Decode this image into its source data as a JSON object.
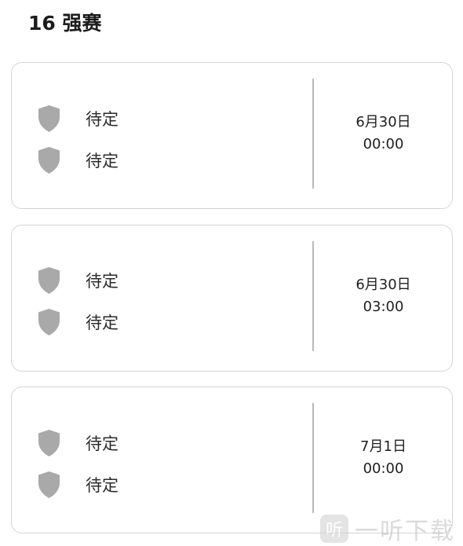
{
  "section": {
    "title": "16 强赛"
  },
  "matches": [
    {
      "home": {
        "name": "待定",
        "icon": "shield-icon"
      },
      "away": {
        "name": "待定",
        "icon": "shield-icon"
      },
      "date": "6月30日",
      "time": "00:00"
    },
    {
      "home": {
        "name": "待定",
        "icon": "shield-icon"
      },
      "away": {
        "name": "待定",
        "icon": "shield-icon"
      },
      "date": "6月30日",
      "time": "03:00"
    },
    {
      "home": {
        "name": "待定",
        "icon": "shield-icon"
      },
      "away": {
        "name": "待定",
        "icon": "shield-icon"
      },
      "date": "7月1日",
      "time": "00:00"
    }
  ],
  "watermark": {
    "logo_char": "听",
    "text": "一听下载"
  },
  "colors": {
    "shield": "#a9a9a9",
    "card_border": "#d4d4d4",
    "divider": "#b8b8b8"
  }
}
